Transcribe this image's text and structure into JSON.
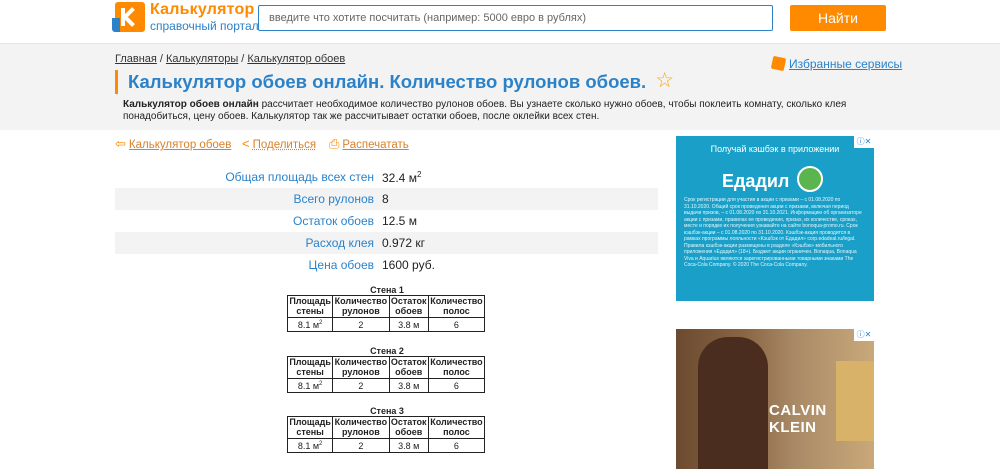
{
  "header": {
    "logo_title": "Калькулятор",
    "logo_subtitle": "справочный портал",
    "search_placeholder": "введите что хотите посчитать (например: 5000 евро в рублях)",
    "search_button": "Найти"
  },
  "breadcrumb": [
    "Главная",
    "Калькуляторы",
    "Калькулятор обоев"
  ],
  "page_title": "Калькулятор обоев онлайн. Количество рулонов обоев.",
  "favorites_link": "Избранные сервисы",
  "description": {
    "bold": "Калькулятор обоев онлайн",
    "text": " рассчитает необходимое количество рулонов обоев. Вы узнаете сколько нужно обоев, чтобы поклеить комнату, сколько клея понадобиться, цену обоев. Калькулятор так же рассчитывает остатки обоев, после оклейки всех стен."
  },
  "actions": {
    "back": "Калькулятор обоев",
    "share": "Поделиться",
    "print": "Распечатать"
  },
  "results": [
    {
      "label": "Общая площадь всех стен",
      "value": "32.4 м",
      "sup": "2"
    },
    {
      "label": "Всего рулонов",
      "value": "8",
      "sup": ""
    },
    {
      "label": "Остаток обоев",
      "value": "12.5 м",
      "sup": ""
    },
    {
      "label": "Расход клея",
      "value": "0.972 кг",
      "sup": ""
    },
    {
      "label": "Цена обоев",
      "value": "1600 руб.",
      "sup": ""
    }
  ],
  "wall_headers": [
    "Площадь стены",
    "Количество рулонов",
    "Остаток обоев",
    "Количество полос"
  ],
  "walls": [
    {
      "title": "Стена 1",
      "area": "8.1 м",
      "sup": "2",
      "rolls": "2",
      "rest": "3.8 м",
      "strips": "6"
    },
    {
      "title": "Стена 2",
      "area": "8.1 м",
      "sup": "2",
      "rolls": "2",
      "rest": "3.8 м",
      "strips": "6"
    },
    {
      "title": "Стена 3",
      "area": "8.1 м",
      "sup": "2",
      "rolls": "2",
      "rest": "3.8 м",
      "strips": "6"
    }
  ],
  "ads": {
    "ad1_promo": "Получай кэшбэк в приложении",
    "ad1_brand": "Едадил",
    "ad1_fine": "Срок регистрации для участия в акции с призами – с 01.08.2020 по 31.10.2020. Общий срок проведения акции с призами, включая период выдачи призов, – с 01.08.2020 по 31.10.2021. Информацию об организаторе акции с призами, правилах ее проведения, призах, их количестве, сроках, месте и порядке их получения узнавайте на сайте bonoqua-promo.ru. Срок кэшбэк-акции – с 01.08.2020 по 31.10.2020. Кэшбэк-акция проводится в рамках программы лояльности «Кэшбэк от Едадил» corp.edadeal.ru/legal. Правила кэшбэк-акции размещены в разделе «Кэшбэк» мобильного приложения «Едадил» (18+). Бюджет акции ограничен. Bonaqua, Bonaqua Viva и Aquarius являются зарегистрированными товарными знаками The Coca-Cola Company. © 2020 The Coca-Cola Company.",
    "ad2_brand": "CALVIN KLEIN",
    "ad_close": "ⓘ✕"
  },
  "colors": {
    "accent": "#ff8a00",
    "link": "#2b82c9",
    "band": "#f3f3f3"
  }
}
